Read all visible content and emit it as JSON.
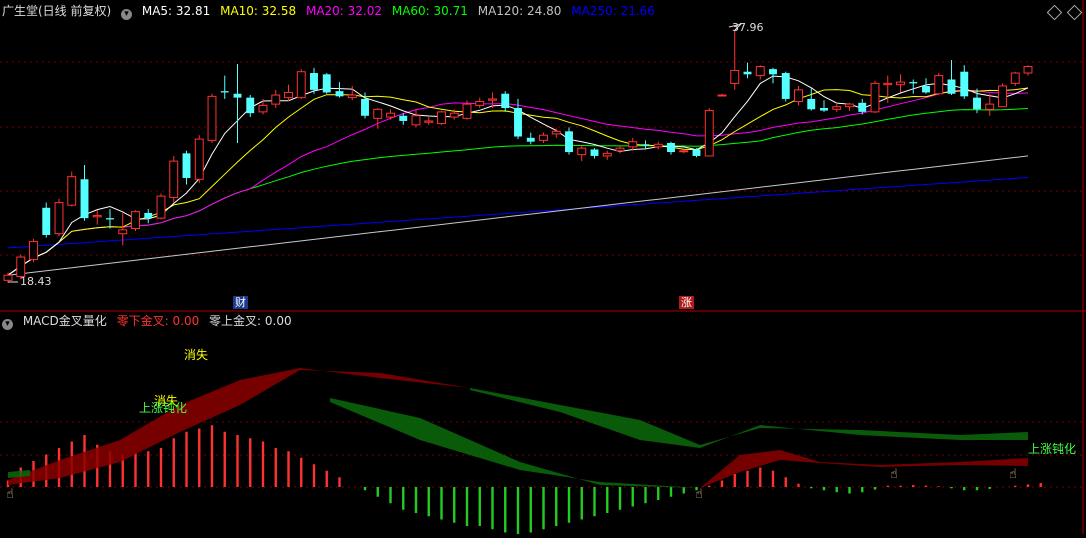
{
  "main_panel": {
    "title": "广生堂(日线 前复权)",
    "indicators": [
      {
        "label": "MA5: 32.81",
        "color": "#ffffff"
      },
      {
        "label": "MA10: 32.58",
        "color": "#ffff00"
      },
      {
        "label": "MA20: 32.02",
        "color": "#ff00ff"
      },
      {
        "label": "MA60: 30.71",
        "color": "#00ff00"
      },
      {
        "label": "MA120: 24.80",
        "color": "#c0c0c0"
      },
      {
        "label": "MA250: 21.66",
        "color": "#0000ff"
      }
    ],
    "high_label": "37.96",
    "low_label": "18.43",
    "event_badge_1": "财",
    "event_badge_2": "涨"
  },
  "sub_panel": {
    "title": "MACD金叉量化",
    "stat_1": "零下金叉: 0.00",
    "stat_2": "零上金叉: 0.00",
    "annotation_1": "消失",
    "annotation_2": "消失",
    "annotation_3": "上涨钝化",
    "annotation_4": "上涨钝化"
  },
  "colors": {
    "up": "#ff3232",
    "down": "#54ffff",
    "grid": "#7a0000"
  },
  "chart_data": {
    "type": "candlestick",
    "ohlc": [
      [
        18.6,
        19.2,
        18.4,
        19.0
      ],
      [
        18.9,
        20.6,
        18.7,
        20.4
      ],
      [
        20.2,
        21.8,
        20.0,
        21.6
      ],
      [
        24.2,
        24.6,
        21.9,
        22.1
      ],
      [
        22.2,
        24.9,
        22.0,
        24.6
      ],
      [
        24.4,
        27.0,
        24.3,
        26.6
      ],
      [
        26.4,
        27.5,
        23.2,
        23.4
      ],
      [
        23.5,
        24.0,
        22.9,
        23.6
      ],
      [
        23.4,
        24.1,
        22.6,
        23.3
      ],
      [
        22.2,
        23.8,
        21.3,
        22.5
      ],
      [
        22.6,
        24.0,
        22.4,
        23.9
      ],
      [
        23.8,
        24.1,
        23.0,
        23.4
      ],
      [
        23.4,
        25.3,
        23.3,
        25.1
      ],
      [
        25.0,
        28.2,
        24.6,
        27.8
      ],
      [
        28.4,
        28.6,
        26.0,
        26.5
      ],
      [
        26.4,
        29.8,
        26.1,
        29.5
      ],
      [
        29.4,
        33.0,
        29.2,
        32.8
      ],
      [
        33.2,
        34.4,
        32.6,
        33.1
      ],
      [
        33.0,
        35.3,
        29.2,
        32.7
      ],
      [
        32.7,
        32.9,
        31.2,
        31.5
      ],
      [
        31.6,
        32.6,
        31.4,
        32.1
      ],
      [
        32.2,
        33.3,
        31.9,
        32.9
      ],
      [
        32.7,
        33.7,
        32.4,
        33.1
      ],
      [
        32.7,
        34.9,
        32.6,
        34.7
      ],
      [
        34.6,
        35.0,
        33.0,
        33.3
      ],
      [
        34.5,
        34.6,
        33.0,
        33.1
      ],
      [
        33.2,
        33.9,
        32.7,
        32.8
      ],
      [
        32.7,
        33.6,
        32.5,
        32.9
      ],
      [
        32.6,
        33.1,
        31.1,
        31.3
      ],
      [
        31.1,
        31.9,
        30.3,
        31.8
      ],
      [
        31.2,
        31.8,
        31.0,
        31.5
      ],
      [
        31.3,
        31.5,
        30.6,
        30.9
      ],
      [
        30.6,
        31.8,
        30.4,
        31.3
      ],
      [
        30.8,
        31.2,
        30.6,
        30.9
      ],
      [
        30.7,
        31.7,
        30.6,
        31.6
      ],
      [
        31.2,
        31.8,
        31.0,
        31.5
      ],
      [
        31.1,
        32.5,
        31.0,
        32.2
      ],
      [
        32.1,
        32.7,
        31.9,
        32.4
      ],
      [
        32.5,
        33.1,
        31.9,
        32.6
      ],
      [
        33.0,
        33.2,
        31.6,
        31.9
      ],
      [
        31.9,
        32.6,
        29.5,
        29.7
      ],
      [
        29.6,
        30.0,
        29.1,
        29.3
      ],
      [
        29.4,
        30.0,
        29.2,
        29.8
      ],
      [
        29.9,
        30.3,
        29.6,
        30.1
      ],
      [
        30.1,
        30.4,
        28.3,
        28.5
      ],
      [
        28.3,
        29.0,
        27.8,
        28.8
      ],
      [
        28.7,
        28.8,
        28.0,
        28.2
      ],
      [
        28.2,
        28.6,
        27.9,
        28.4
      ],
      [
        28.6,
        29.0,
        28.4,
        28.8
      ],
      [
        28.9,
        29.6,
        28.6,
        29.3
      ],
      [
        29.1,
        29.4,
        28.7,
        29.0
      ],
      [
        28.9,
        29.3,
        28.7,
        29.1
      ],
      [
        29.2,
        29.3,
        28.3,
        28.5
      ],
      [
        28.6,
        28.7,
        28.4,
        28.6
      ],
      [
        28.7,
        28.8,
        28.1,
        28.2
      ],
      [
        28.2,
        31.9,
        28.2,
        31.7
      ],
      [
        32.9,
        33.0,
        32.9,
        32.9
      ],
      [
        33.8,
        37.9,
        33.3,
        34.8
      ],
      [
        34.7,
        35.4,
        34.2,
        34.5
      ],
      [
        34.4,
        35.2,
        34.1,
        35.1
      ],
      [
        34.9,
        35.0,
        33.8,
        34.5
      ],
      [
        34.6,
        34.7,
        32.4,
        32.6
      ],
      [
        32.4,
        33.6,
        32.1,
        33.3
      ],
      [
        32.6,
        33.4,
        31.7,
        31.8
      ],
      [
        31.9,
        32.5,
        31.6,
        31.7
      ],
      [
        31.8,
        32.3,
        31.6,
        32.0
      ],
      [
        32.0,
        32.3,
        31.7,
        32.2
      ],
      [
        32.3,
        32.6,
        31.4,
        31.6
      ],
      [
        31.6,
        34.0,
        31.5,
        33.8
      ],
      [
        33.7,
        34.4,
        32.3,
        33.8
      ],
      [
        33.7,
        34.5,
        33.1,
        33.9
      ],
      [
        33.9,
        34.1,
        33.0,
        33.8
      ],
      [
        33.6,
        34.2,
        33.0,
        33.1
      ],
      [
        33.0,
        34.6,
        32.9,
        34.4
      ],
      [
        34.1,
        35.6,
        32.9,
        33.0
      ],
      [
        34.7,
        35.2,
        32.6,
        32.8
      ],
      [
        32.7,
        33.4,
        31.5,
        31.8
      ],
      [
        31.8,
        33.0,
        31.3,
        32.2
      ],
      [
        32.0,
        33.8,
        32.0,
        33.6
      ],
      [
        33.8,
        34.7,
        33.6,
        34.6
      ],
      [
        34.6,
        35.2,
        34.4,
        35.1
      ]
    ],
    "price_range": [
      17.7,
      39.0
    ],
    "macd_hist": [
      0.1,
      0.3,
      0.4,
      0.5,
      0.6,
      0.7,
      0.8,
      0.65,
      0.55,
      0.5,
      0.52,
      0.55,
      0.6,
      0.75,
      0.85,
      0.9,
      0.95,
      0.85,
      0.8,
      0.75,
      0.7,
      0.6,
      0.55,
      0.45,
      0.35,
      0.25,
      0.15,
      0,
      -0.05,
      -0.15,
      -0.25,
      -0.35,
      -0.4,
      -0.45,
      -0.5,
      -0.55,
      -0.6,
      -0.6,
      -0.65,
      -0.7,
      -0.75,
      -0.7,
      -0.65,
      -0.6,
      -0.55,
      -0.5,
      -0.45,
      -0.4,
      -0.35,
      -0.3,
      -0.25,
      -0.2,
      -0.15,
      -0.1,
      -0.05,
      0.02,
      0.1,
      0.2,
      0.25,
      0.3,
      0.25,
      0.15,
      0.05,
      -0.02,
      -0.05,
      -0.08,
      -0.1,
      -0.08,
      -0.04,
      0.02,
      0.02,
      0.03,
      0.02,
      0.01,
      -0.02,
      -0.05,
      -0.05,
      -0.03,
      0.0,
      0.02,
      0.04,
      0.06
    ]
  }
}
